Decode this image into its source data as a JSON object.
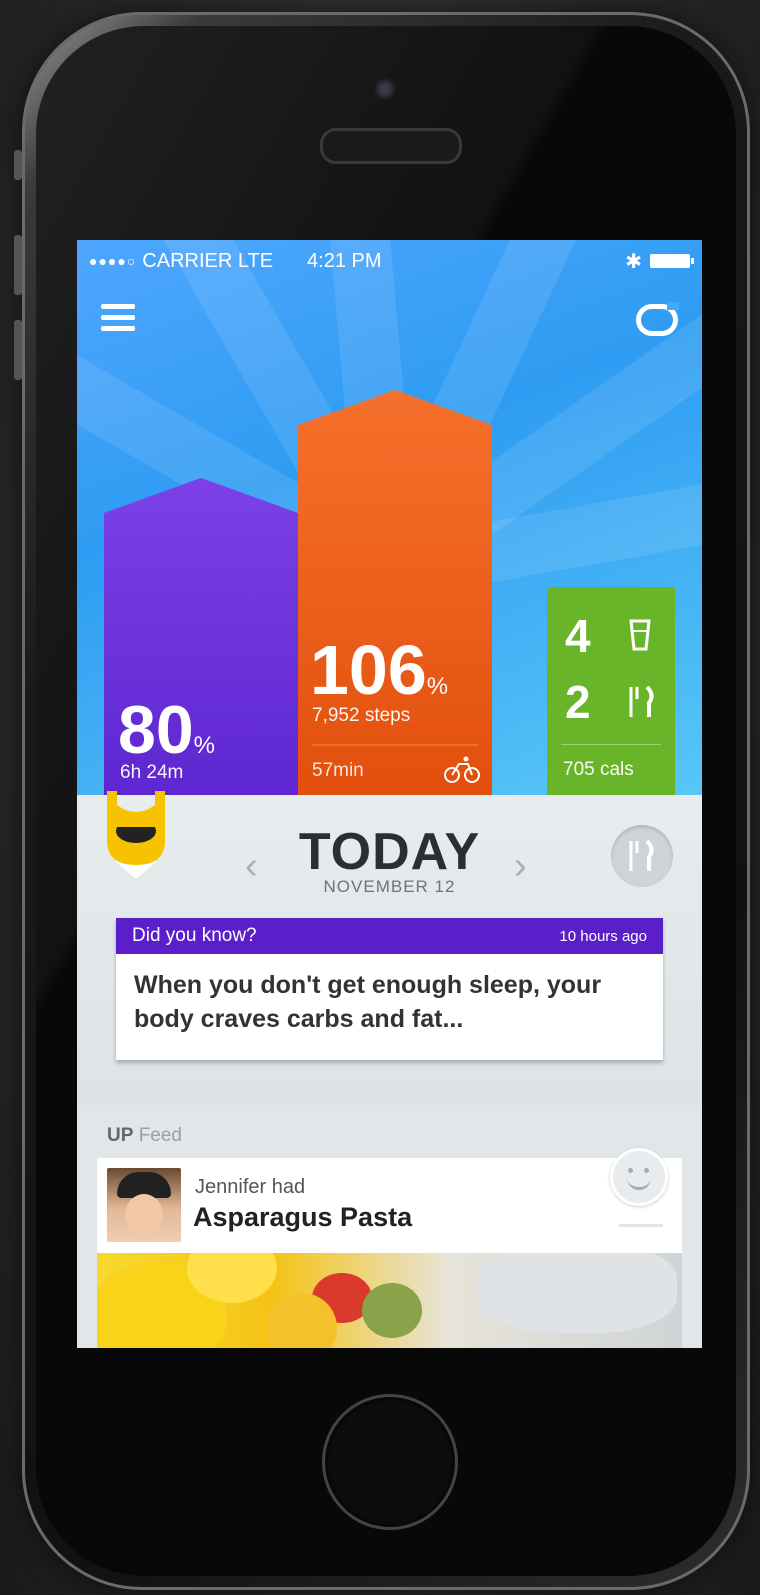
{
  "status_bar": {
    "signal": "●●●●○",
    "carrier": "CARRIER LTE",
    "time": "4:21 PM",
    "bluetooth": "✱"
  },
  "header": {
    "menu_icon": "hamburger-menu-icon",
    "sync_icon": "band-sync-icon"
  },
  "stats": {
    "sleep": {
      "value": "80",
      "unit": "%",
      "detail": "6h 24m",
      "color": "#6a2ee0",
      "level": 0.8
    },
    "move": {
      "value": "106",
      "unit": "%",
      "detail": "7,952 steps",
      "active": "57min",
      "color": "#f05a14",
      "level": 1.06
    },
    "food": {
      "drinks": "4",
      "meals": "2",
      "calories": "705 cals",
      "color": "#69b52a"
    }
  },
  "day_nav": {
    "prev": "‹",
    "next": "›",
    "title": "TODAY",
    "date": "NOVEMBER 12"
  },
  "insight_card": {
    "label": "Did you know?",
    "time_ago": "10 hours ago",
    "text": "When you don't get enough sleep, your body craves carbs and fat...",
    "accent": "#5b1fc9"
  },
  "feed": {
    "label_bold": "UP",
    "label": "Feed",
    "items": [
      {
        "actor_line": "Jennifer had",
        "title": "Asparagus Pasta"
      }
    ]
  }
}
